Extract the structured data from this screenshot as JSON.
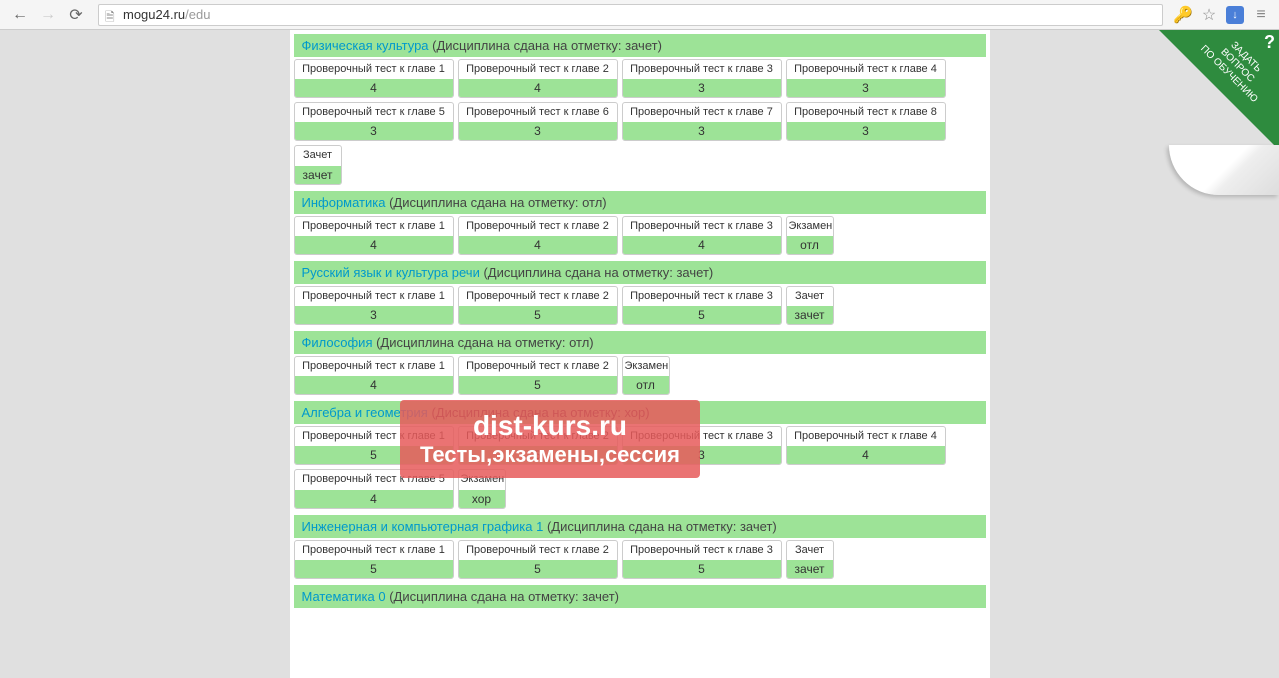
{
  "browser": {
    "url_domain": "mogu24.ru",
    "url_path": "/edu"
  },
  "corner": {
    "line1": "ЗАДАТЬ",
    "line2": "ВОПРОС",
    "line3": "ПО ОБУЧЕНИЮ",
    "q": "?"
  },
  "watermark": {
    "line1": "dist-kurs.ru",
    "line2": "Тесты,экзамены,сессия"
  },
  "disciplines": [
    {
      "name": "Физическая культура",
      "status": "(Дисциплина сдана на отметку: зачет)",
      "tests": [
        {
          "name": "Проверочный тест к главе 1",
          "score": "4"
        },
        {
          "name": "Проверочный тест к главе 2",
          "score": "4"
        },
        {
          "name": "Проверочный тест к главе 3",
          "score": "3"
        },
        {
          "name": "Проверочный тест к главе 4",
          "score": "3"
        },
        {
          "name": "Проверочный тест к главе 5",
          "score": "3"
        },
        {
          "name": "Проверочный тест к главе 6",
          "score": "3"
        },
        {
          "name": "Проверочный тест к главе 7",
          "score": "3"
        },
        {
          "name": "Проверочный тест к главе 8",
          "score": "3"
        },
        {
          "name": "Зачет",
          "score": "зачет",
          "narrow": true
        }
      ]
    },
    {
      "name": "Информатика",
      "status": "(Дисциплина сдана на отметку: отл)",
      "tests": [
        {
          "name": "Проверочный тест к главе 1",
          "score": "4"
        },
        {
          "name": "Проверочный тест к главе 2",
          "score": "4"
        },
        {
          "name": "Проверочный тест к главе 3",
          "score": "4"
        },
        {
          "name": "Экзамен",
          "score": "отл",
          "narrow": true
        }
      ]
    },
    {
      "name": "Русский язык и культура речи",
      "status": "(Дисциплина сдана на отметку: зачет)",
      "tests": [
        {
          "name": "Проверочный тест к главе 1",
          "score": "3"
        },
        {
          "name": "Проверочный тест к главе 2",
          "score": "5"
        },
        {
          "name": "Проверочный тест к главе 3",
          "score": "5"
        },
        {
          "name": "Зачет",
          "score": "зачет",
          "narrow": true
        }
      ]
    },
    {
      "name": "Философия",
      "status": "(Дисциплина сдана на отметку: отл)",
      "tests": [
        {
          "name": "Проверочный тест к главе 1",
          "score": "4"
        },
        {
          "name": "Проверочный тест к главе 2",
          "score": "5"
        },
        {
          "name": "Экзамен",
          "score": "отл",
          "narrow": true
        }
      ]
    },
    {
      "name": "Алгебра и геометрия",
      "status": "(Дисциплина сдана на отметку: хор)",
      "tests": [
        {
          "name": "Проверочный тест к главе 1",
          "score": "5"
        },
        {
          "name": "Проверочный тест к главе 2",
          "score": "5"
        },
        {
          "name": "Проверочный тест к главе 3",
          "score": "3"
        },
        {
          "name": "Проверочный тест к главе 4",
          "score": "4"
        },
        {
          "name": "Проверочный тест к главе 5",
          "score": "4"
        },
        {
          "name": "Экзамен",
          "score": "хор",
          "narrow": true
        }
      ]
    },
    {
      "name": "Инженерная и компьютерная графика 1",
      "status": "(Дисциплина сдана на отметку: зачет)",
      "tests": [
        {
          "name": "Проверочный тест к главе 1",
          "score": "5"
        },
        {
          "name": "Проверочный тест к главе 2",
          "score": "5"
        },
        {
          "name": "Проверочный тест к главе 3",
          "score": "5"
        },
        {
          "name": "Зачет",
          "score": "зачет",
          "narrow": true
        }
      ]
    },
    {
      "name": "Математика 0",
      "status": "(Дисциплина сдана на отметку: зачет)",
      "tests": []
    }
  ]
}
